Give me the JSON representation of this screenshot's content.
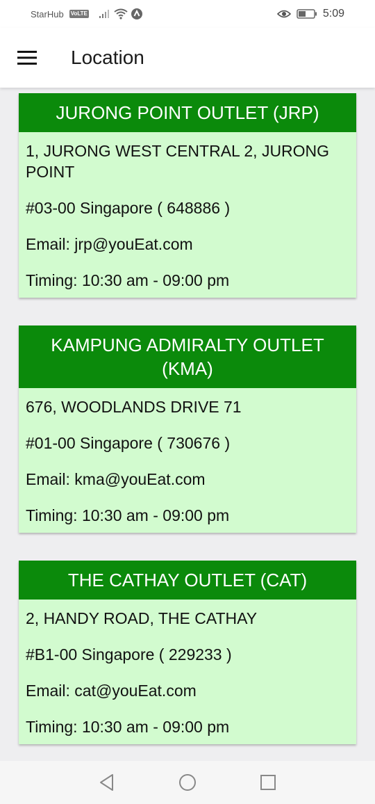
{
  "status_bar": {
    "carrier": "StarHub",
    "volte": "VoLTE",
    "time": "5:09",
    "icons": [
      "signal-icon",
      "wifi-icon",
      "nfc-icon",
      "eye-comfort-icon",
      "battery-icon"
    ]
  },
  "app_bar": {
    "title": "Location",
    "menu_icon": "hamburger-menu-icon"
  },
  "outlets": [
    {
      "name": "JURONG POINT OUTLET (JRP)",
      "address": "1, JURONG WEST CENTRAL 2, JURONG POINT",
      "unit": "#03-00 Singapore ( 648886 )",
      "email": "Email: jrp@youEat.com",
      "timing": "Timing: 10:30 am - 09:00 pm"
    },
    {
      "name": "KAMPUNG ADMIRALTY OUTLET (KMA)",
      "address": "676, WOODLANDS DRIVE 71",
      "unit": "#01-00 Singapore ( 730676 )",
      "email": "Email: kma@youEat.com",
      "timing": "Timing: 10:30 am - 09:00 pm"
    },
    {
      "name": "THE CATHAY OUTLET (CAT)",
      "address": "2, HANDY ROAD, THE CATHAY",
      "unit": "#B1-00 Singapore ( 229233 )",
      "email": "Email: cat@youEat.com",
      "timing": "Timing: 10:30 am - 09:00 pm"
    }
  ],
  "nav_bar": {
    "buttons": [
      "back-icon",
      "home-icon",
      "recents-icon"
    ]
  },
  "colors": {
    "header_green": "#0b8a0b",
    "card_background": "#d2fbcf",
    "page_background": "#eeeef0"
  }
}
